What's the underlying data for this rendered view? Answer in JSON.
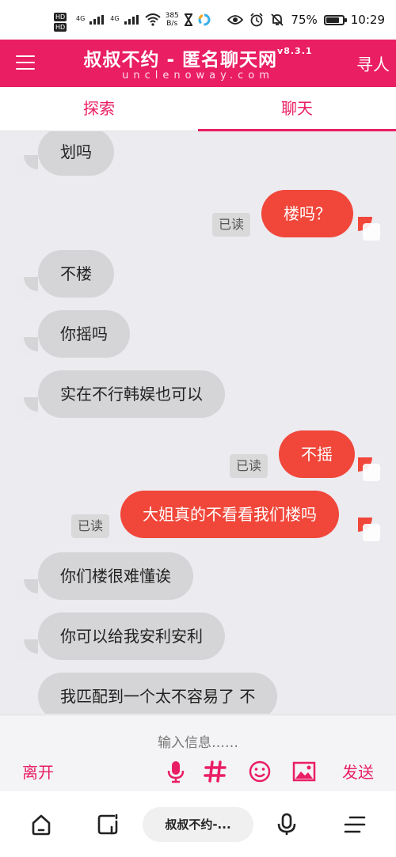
{
  "status_bar": {
    "net1": "4G",
    "net2": "4G",
    "speed_value": "385",
    "speed_unit": "B/s",
    "battery": "75%",
    "battery_level": 0.75,
    "time": "10:29"
  },
  "app_bar": {
    "title": "叔叔不约 - 匿名聊天网",
    "version": "v8.3.1",
    "domain": "unclenoway.com",
    "action": "寻人"
  },
  "tabs": [
    {
      "label": "探索"
    },
    {
      "label": "聊天"
    }
  ],
  "messages": [
    {
      "dir": "in",
      "text": "划吗"
    },
    {
      "dir": "out",
      "text": "楼吗？",
      "status": "已读"
    },
    {
      "dir": "in",
      "text": "不楼"
    },
    {
      "dir": "in",
      "text": "你摇吗"
    },
    {
      "dir": "in",
      "text": "实在不行韩娱也可以"
    },
    {
      "dir": "out",
      "text": "不摇",
      "status": "已读"
    },
    {
      "dir": "out",
      "text": "大姐真的不看看我们楼吗",
      "status": "已读"
    },
    {
      "dir": "in",
      "text": "你们楼很难懂诶"
    },
    {
      "dir": "in",
      "text": "你可以给我安利安利"
    },
    {
      "dir": "in",
      "text": "我匹配到一个太不容易了 不"
    }
  ],
  "input_bar": {
    "placeholder": "输入信息……",
    "leave_label": "离开",
    "send_label": "发送",
    "icons": [
      "microphone-icon",
      "hash-icon",
      "emoji-icon",
      "image-icon"
    ]
  },
  "nav_bar": {
    "pill_label": "叔叔不约-..."
  },
  "colors": {
    "brand": "#e91e63",
    "outgoing_bubble": "#f0473a",
    "incoming_bubble": "#d5d5d7",
    "chat_background": "#ecebf0"
  }
}
